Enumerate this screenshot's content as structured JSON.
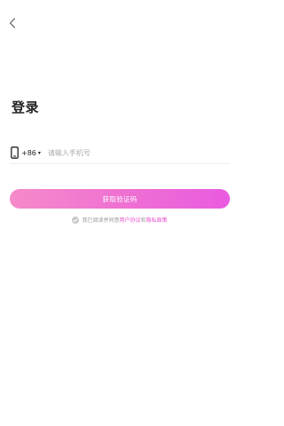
{
  "icons": {
    "back": "chevron-left-icon",
    "phone": "mobile-phone-icon",
    "caret": "caret-down-icon",
    "checkbox": "check-circle-icon"
  },
  "login": {
    "title": "登录",
    "country_code": "+86",
    "caret": "▾",
    "phone_placeholder": "请输入手机号",
    "phone_value": "",
    "submit_label": "获取验证码"
  },
  "agreement": {
    "prefix": "我已阅读并同意",
    "user_agreement": "用户协议",
    "and": "和",
    "privacy_policy": "隐私政策"
  },
  "colors": {
    "accent_start": "#f58ac9",
    "accent_end": "#e95be0",
    "link": "#e84fcf"
  }
}
